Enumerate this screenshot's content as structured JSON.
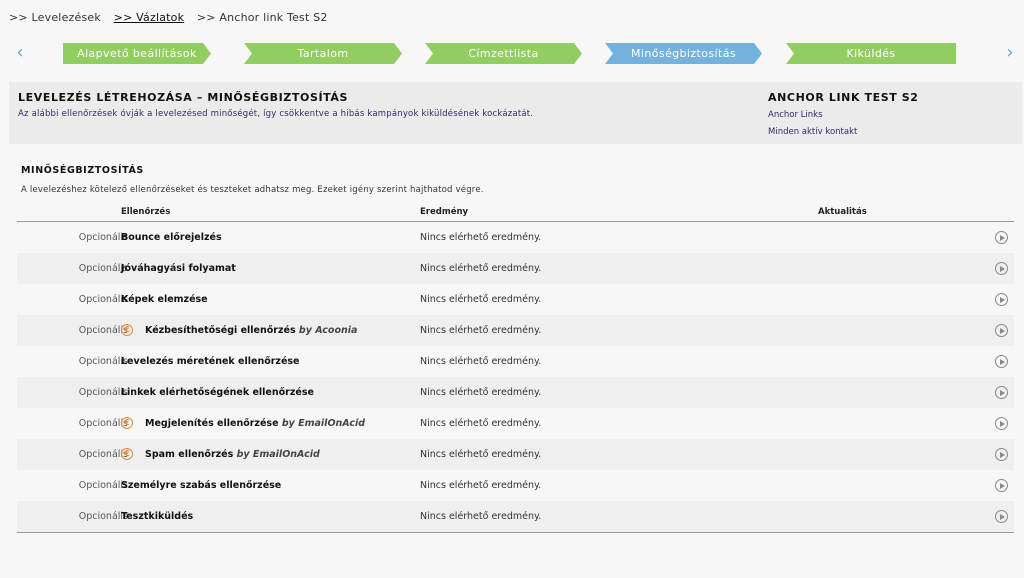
{
  "breadcrumb": {
    "items": [
      ">> Levelezések",
      ">> Vázlatok",
      ">> Anchor link Test S2"
    ]
  },
  "steps": [
    "Alapvető beállítások",
    "Tartalom",
    "Címzettlista",
    "Minőségbiztosítás",
    "Kiküldés"
  ],
  "active_step": "Minőségbiztosítás",
  "info": {
    "title": "LEVELEZÉS LÉTREHOZÁSA – MINŐSÉGBIZTOSÍTÁS",
    "description": "Az alábbi ellenőrzések óvják a levelezésed minőségét, így csökkentve a hibás kampányok kiküldésének kockázatát.",
    "campaign_name": "ANCHOR LINK TEST S2",
    "campaign_type": "Anchor Links",
    "campaign_audience": "Minden aktív kontakt"
  },
  "section": {
    "title": "MINŐSÉGBIZTOSÍTÁS",
    "description": "A levelezéshez kötelező ellenőrzéseket és teszteket adhatsz meg. Ezeket igény szerint hajthatod végre."
  },
  "table": {
    "headers": {
      "check": "Ellenőrzés",
      "result": "Eredmény",
      "updated": "Aktualitás"
    },
    "rows": [
      {
        "status": "Opcionális",
        "name": "Bounce előrejelzés",
        "by": "",
        "paid": false,
        "result": "Nincs elérhető eredmény."
      },
      {
        "status": "Opcionális",
        "name": "Jóváhagyási folyamat",
        "by": "",
        "paid": false,
        "result": "Nincs elérhető eredmény."
      },
      {
        "status": "Opcionális",
        "name": "Képek elemzése",
        "by": "",
        "paid": false,
        "result": "Nincs elérhető eredmény."
      },
      {
        "status": "Opcionális",
        "name": "Kézbesíthetőségi ellenőrzés",
        "by": "by Acoonia",
        "paid": true,
        "result": "Nincs elérhető eredmény."
      },
      {
        "status": "Opcionális",
        "name": "Levelezés méretének ellenőrzése",
        "by": "",
        "paid": false,
        "result": "Nincs elérhető eredmény."
      },
      {
        "status": "Opcionális",
        "name": "Linkek elérhetőségének ellenőrzése",
        "by": "",
        "paid": false,
        "result": "Nincs elérhető eredmény."
      },
      {
        "status": "Opcionális",
        "name": "Megjelenítés ellenőrzése",
        "by": "by EmailOnAcid",
        "paid": true,
        "result": "Nincs elérhető eredmény."
      },
      {
        "status": "Opcionális",
        "name": "Spam ellenőrzés",
        "by": "by EmailOnAcid",
        "paid": true,
        "result": "Nincs elérhető eredmény."
      },
      {
        "status": "Opcionális",
        "name": "Személyre szabás ellenőrzése",
        "by": "",
        "paid": false,
        "result": "Nincs elérhető eredmény."
      },
      {
        "status": "Opcionális",
        "name": "Tesztkiküldés",
        "by": "",
        "paid": false,
        "result": "Nincs elérhető eredmény."
      }
    ]
  },
  "icons": {
    "prev": "chevron-left-icon",
    "next": "chevron-right-icon",
    "paid": "euro-icon",
    "run": "play-circle-icon"
  },
  "colors": {
    "step_done": "#92cd62",
    "step_active": "#74b2de",
    "paid_icon": "#e58b3a"
  }
}
